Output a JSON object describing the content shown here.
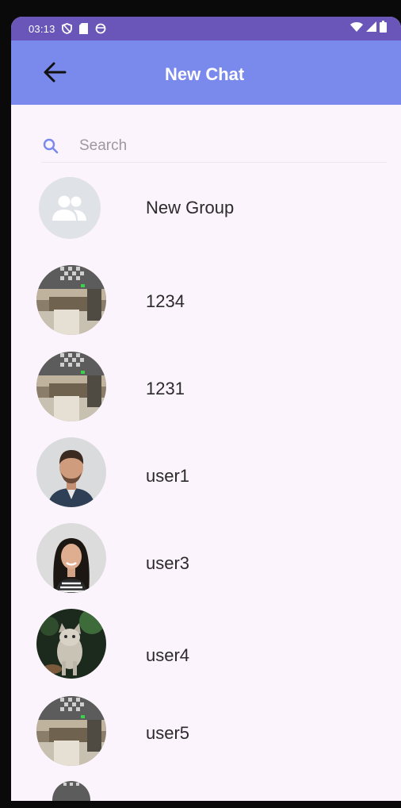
{
  "status_bar": {
    "time": "03:13",
    "left_icons": [
      "shield-icon",
      "sd-card-icon",
      "circle-status-icon"
    ],
    "right_icons": [
      "wifi-icon",
      "signal-icon",
      "battery-icon"
    ]
  },
  "app_bar": {
    "title": "New Chat",
    "back_icon": "arrow-left-icon"
  },
  "search": {
    "placeholder": "Search",
    "value": ""
  },
  "new_group": {
    "label": "New Group",
    "icon": "group-icon"
  },
  "contacts": [
    {
      "name": "1234",
      "avatar": "room-photo"
    },
    {
      "name": "1231",
      "avatar": "room-photo"
    },
    {
      "name": "user1",
      "avatar": "man-portrait"
    },
    {
      "name": "user3",
      "avatar": "woman-portrait"
    },
    {
      "name": "user4",
      "avatar": "cat-photo"
    },
    {
      "name": "user5",
      "avatar": "room-photo"
    }
  ],
  "colors": {
    "status_bar": "#6a56b8",
    "app_bar": "#7a89ec",
    "background": "#fcf4fc",
    "search_accent": "#7a89ec"
  }
}
